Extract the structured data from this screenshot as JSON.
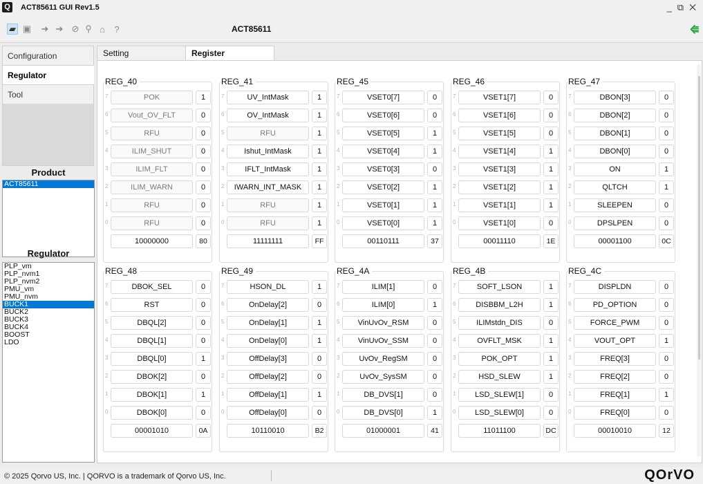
{
  "window": {
    "title": "ACT85611 GUI Rev1.5",
    "logo": "Q",
    "controls": "_ ⧉ ✕"
  },
  "toolbar": {
    "title": "ACT85611",
    "usb_icon": "usb-connected-icon"
  },
  "nav": {
    "items": [
      "Configuration",
      "Regulator",
      "Tool"
    ],
    "selected": "Regulator"
  },
  "product": {
    "label": "Product",
    "items": [
      "ACT85611"
    ],
    "selected": "ACT85611"
  },
  "regulator_list": {
    "label": "Regulator",
    "items": [
      "PLP_vm",
      "PLP_nvm1",
      "PLP_nvm2",
      "PMU_vm",
      "PMU_nvm",
      "BUCK1",
      "BUCK2",
      "BUCK3",
      "BUCK4",
      "BOOST",
      "LDO"
    ],
    "selected": "BUCK1"
  },
  "tabs": [
    "Setting",
    "Register"
  ],
  "active_tab": "Register",
  "registers": [
    {
      "name": "REG_40",
      "bits": [
        {
          "n": "POK",
          "v": "1",
          "d": true
        },
        {
          "n": "Vout_OV_FLT",
          "v": "0",
          "d": true
        },
        {
          "n": "RFU",
          "v": "0",
          "d": true
        },
        {
          "n": "ILIM_SHUT",
          "v": "0",
          "d": true
        },
        {
          "n": "ILIM_FLT",
          "v": "0",
          "d": true
        },
        {
          "n": "ILIM_WARN",
          "v": "0",
          "d": true
        },
        {
          "n": "RFU",
          "v": "0",
          "d": true
        },
        {
          "n": "RFU",
          "v": "0",
          "d": true
        }
      ],
      "bin": "10000000",
      "hex": "80"
    },
    {
      "name": "REG_41",
      "bits": [
        {
          "n": "UV_IntMask",
          "v": "1"
        },
        {
          "n": "OV_IntMask",
          "v": "1"
        },
        {
          "n": "RFU",
          "v": "1",
          "d": true
        },
        {
          "n": "Ishut_IntMask",
          "v": "1"
        },
        {
          "n": "IFLT_IntMask",
          "v": "1"
        },
        {
          "n": "IWARN_INT_MASK",
          "v": "1"
        },
        {
          "n": "RFU",
          "v": "1",
          "d": true
        },
        {
          "n": "RFU",
          "v": "1",
          "d": true
        }
      ],
      "bin": "11111111",
      "hex": "FF"
    },
    {
      "name": "REG_45",
      "bits": [
        {
          "n": "VSET0[7]",
          "v": "0"
        },
        {
          "n": "VSET0[6]",
          "v": "0"
        },
        {
          "n": "VSET0[5]",
          "v": "1"
        },
        {
          "n": "VSET0[4]",
          "v": "1"
        },
        {
          "n": "VSET0[3]",
          "v": "0"
        },
        {
          "n": "VSET0[2]",
          "v": "1"
        },
        {
          "n": "VSET0[1]",
          "v": "1"
        },
        {
          "n": "VSET0[0]",
          "v": "1"
        }
      ],
      "bin": "00110111",
      "hex": "37"
    },
    {
      "name": "REG_46",
      "bits": [
        {
          "n": "VSET1[7]",
          "v": "0"
        },
        {
          "n": "VSET1[6]",
          "v": "0"
        },
        {
          "n": "VSET1[5]",
          "v": "0"
        },
        {
          "n": "VSET1[4]",
          "v": "1"
        },
        {
          "n": "VSET1[3]",
          "v": "1"
        },
        {
          "n": "VSET1[2]",
          "v": "1"
        },
        {
          "n": "VSET1[1]",
          "v": "1"
        },
        {
          "n": "VSET1[0]",
          "v": "0"
        }
      ],
      "bin": "00011110",
      "hex": "1E"
    },
    {
      "name": "REG_47",
      "bits": [
        {
          "n": "DBON[3]",
          "v": "0"
        },
        {
          "n": "DBON[2]",
          "v": "0"
        },
        {
          "n": "DBON[1]",
          "v": "0"
        },
        {
          "n": "DBON[0]",
          "v": "0"
        },
        {
          "n": "ON",
          "v": "1"
        },
        {
          "n": "QLTCH",
          "v": "1"
        },
        {
          "n": "SLEEPEN",
          "v": "0"
        },
        {
          "n": "DPSLPEN",
          "v": "0"
        }
      ],
      "bin": "00001100",
      "hex": "0C"
    },
    {
      "name": "REG_48",
      "bits": [
        {
          "n": "DBOK_SEL",
          "v": "0"
        },
        {
          "n": "RST",
          "v": "0"
        },
        {
          "n": "DBQL[2]",
          "v": "0"
        },
        {
          "n": "DBQL[1]",
          "v": "0"
        },
        {
          "n": "DBQL[0]",
          "v": "1"
        },
        {
          "n": "DBOK[2]",
          "v": "0"
        },
        {
          "n": "DBOK[1]",
          "v": "1"
        },
        {
          "n": "DBOK[0]",
          "v": "0"
        }
      ],
      "bin": "00001010",
      "hex": "0A"
    },
    {
      "name": "REG_49",
      "bits": [
        {
          "n": "HSON_DL",
          "v": "1"
        },
        {
          "n": "OnDelay[2]",
          "v": "0"
        },
        {
          "n": "OnDelay[1]",
          "v": "1"
        },
        {
          "n": "OnDelay[0]",
          "v": "1"
        },
        {
          "n": "OffDelay[3]",
          "v": "0"
        },
        {
          "n": "OffDelay[2]",
          "v": "0"
        },
        {
          "n": "OffDelay[1]",
          "v": "1"
        },
        {
          "n": "OffDelay[0]",
          "v": "0"
        }
      ],
      "bin": "10110010",
      "hex": "B2"
    },
    {
      "name": "REG_4A",
      "bits": [
        {
          "n": "ILIM[1]",
          "v": "0"
        },
        {
          "n": "ILIM[0]",
          "v": "1"
        },
        {
          "n": "VinUvOv_RSM",
          "v": "0"
        },
        {
          "n": "VinUvOv_SSM",
          "v": "0"
        },
        {
          "n": "UvOv_RegSM",
          "v": "0"
        },
        {
          "n": "UvOv_SysSM",
          "v": "0"
        },
        {
          "n": "DB_DVS[1]",
          "v": "0"
        },
        {
          "n": "DB_DVS[0]",
          "v": "1"
        }
      ],
      "bin": "01000001",
      "hex": "41"
    },
    {
      "name": "REG_4B",
      "bits": [
        {
          "n": "SOFT_LSON",
          "v": "1"
        },
        {
          "n": "DISBBM_L2H",
          "v": "1"
        },
        {
          "n": "ILIMstdn_DIS",
          "v": "0"
        },
        {
          "n": "OVFLT_MSK",
          "v": "1"
        },
        {
          "n": "POK_OPT",
          "v": "1"
        },
        {
          "n": "HSD_SLEW",
          "v": "1"
        },
        {
          "n": "LSD_SLEW[1]",
          "v": "0"
        },
        {
          "n": "LSD_SLEW[0]",
          "v": "0"
        }
      ],
      "bin": "11011100",
      "hex": "DC"
    },
    {
      "name": "REG_4C",
      "bits": [
        {
          "n": "DISPLDN",
          "v": "0"
        },
        {
          "n": "PD_OPTION",
          "v": "0"
        },
        {
          "n": "FORCE_PWM",
          "v": "0"
        },
        {
          "n": "VOUT_OPT",
          "v": "1"
        },
        {
          "n": "FREQ[3]",
          "v": "0"
        },
        {
          "n": "FREQ[2]",
          "v": "0"
        },
        {
          "n": "FREQ[1]",
          "v": "1"
        },
        {
          "n": "FREQ[0]",
          "v": "0"
        }
      ],
      "bin": "00010010",
      "hex": "12"
    }
  ],
  "bit_indices": [
    "7",
    "6",
    "5",
    "4",
    "3",
    "2",
    "1",
    "0"
  ],
  "status": {
    "copyright": "© 2025  Qorvo US, Inc. | QORVO is a trademark of Qorvo US, Inc.",
    "brand": "QOrVO"
  }
}
